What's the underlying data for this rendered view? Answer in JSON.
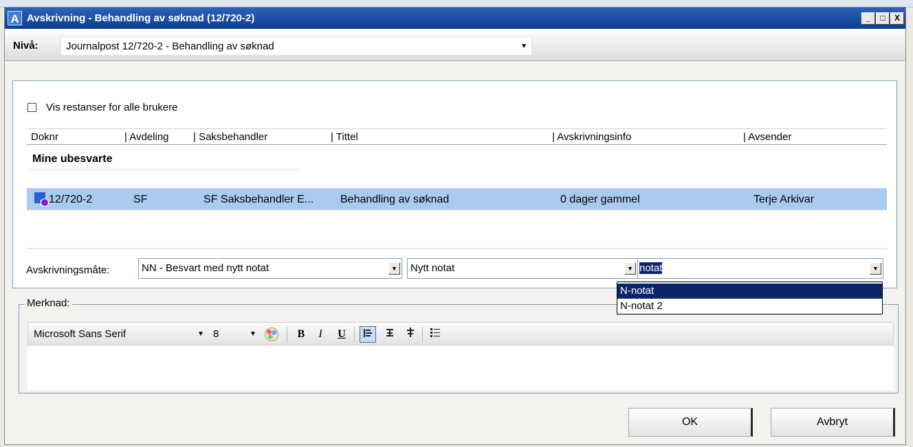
{
  "window": {
    "app_icon_letter": "A",
    "title": "Avskrivning - Behandling av søknad (12/720-2)",
    "buttons": {
      "minimize": "_",
      "maximize": "□",
      "close": "X"
    }
  },
  "niva": {
    "label": "Nivå:",
    "value": "Journalpost 12/720-2 - Behandling av søknad"
  },
  "checkbox": {
    "label": "Vis restanser for alle brukere",
    "checked": false
  },
  "grid": {
    "columns": [
      "Doknr",
      "| Avdeling",
      "| Saksbehandler",
      "| Tittel",
      "| Avskrivningsinfo",
      "| Avsender"
    ],
    "group_title": "Mine ubesvarte",
    "rows": [
      {
        "icon": "N",
        "doknr": "12/720-2",
        "avdeling": "SF",
        "saksbehandler": "SF Saksbehandler E...",
        "tittel": "Behandling av søknad",
        "avskrivningsinfo": "0 dager gammel",
        "avsender": "Terje Arkivar"
      }
    ]
  },
  "avskrivning": {
    "label": "Avskrivningsmåte:",
    "combo1": "NN - Besvart med nytt notat",
    "combo2": "Nytt notat",
    "combo3_text": "notat",
    "dropdown_options": [
      "N-notat",
      "N-notat 2"
    ],
    "selected_option": "N-notat"
  },
  "merknad": {
    "label": "Merknad:",
    "font": "Microsoft Sans Serif",
    "size": "8",
    "bold": "B",
    "italic": "I",
    "underline": "U"
  },
  "buttons": {
    "ok": "OK",
    "cancel": "Avbryt"
  },
  "colors": {
    "titlebar": "#0a3d92",
    "row_selected": "#a9cbef",
    "dropdown_selected": "#0a246a"
  }
}
